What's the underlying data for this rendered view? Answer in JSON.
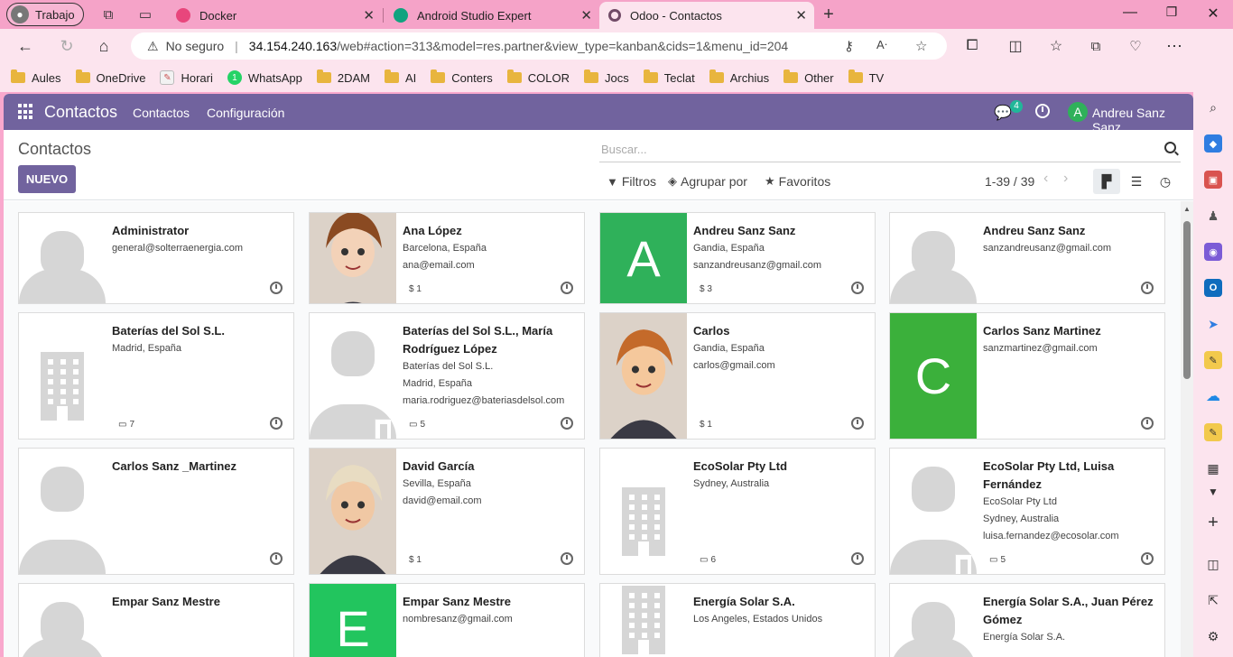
{
  "browser": {
    "profile": "Trabajo",
    "tabs": [
      {
        "title": "Docker",
        "color": "#e8467c"
      },
      {
        "title": "Android Studio Expert",
        "color": "#10a37f"
      },
      {
        "title": "Odoo - Contactos",
        "color": "#714b67"
      }
    ],
    "address": {
      "warning": "No seguro",
      "host": "34.154.240.163",
      "path": "/web#action=313&model=res.partner&view_type=kanban&cids=1&menu_id=204"
    },
    "bookmarks": [
      "Aules",
      "OneDrive",
      "Horari",
      "WhatsApp",
      "2DAM",
      "AI",
      "Conters",
      "COLOR",
      "Jocs",
      "Teclat",
      "Archius",
      "Other",
      "TV"
    ]
  },
  "odoo": {
    "brand": "Contactos",
    "menu": [
      "Contactos",
      "Configuración"
    ],
    "chat_count": "4",
    "user_initial": "A",
    "user_name": "Andreu Sanz Sanz",
    "page_title": "Contactos",
    "new_button": "NUEVO",
    "search_placeholder": "Buscar...",
    "filters_label": "Filtros",
    "group_label": "Agrupar por",
    "favorites_label": "Favoritos",
    "pager": "1-39 / 39",
    "accent": "#71639e"
  },
  "contacts": [
    {
      "name": "Administrator",
      "lines": [
        "general@solterraenergia.com"
      ],
      "meta": ""
    },
    {
      "name": "Ana López",
      "lines": [
        "Barcelona, España",
        "ana@email.com"
      ],
      "meta": "$ 1"
    },
    {
      "name": "Andreu Sanz Sanz",
      "lines": [
        "Gandia, España",
        "sanzandreusanz@gmail.com"
      ],
      "meta": "$ 3"
    },
    {
      "name": "Andreu Sanz Sanz",
      "lines": [
        "sanzandreusanz@gmail.com"
      ],
      "meta": ""
    },
    {
      "name": "Baterías del Sol S.L.",
      "lines": [
        "Madrid, España"
      ],
      "meta": "7"
    },
    {
      "name": "Baterías del Sol S.L., María Rodríguez López",
      "lines": [
        "Baterías del Sol S.L.",
        "Madrid, España",
        "maria.rodriguez@bateriasdelsol.com"
      ],
      "meta": "5"
    },
    {
      "name": "Carlos",
      "lines": [
        "Gandia, España",
        "carlos@gmail.com"
      ],
      "meta": "$ 1"
    },
    {
      "name": "Carlos Sanz Martinez",
      "lines": [
        "sanzmartinez@gmail.com"
      ],
      "meta": ""
    },
    {
      "name": "Carlos Sanz _Martinez",
      "lines": [],
      "meta": ""
    },
    {
      "name": "David García",
      "lines": [
        "Sevilla, España",
        "david@email.com"
      ],
      "meta": "$ 1"
    },
    {
      "name": "EcoSolar Pty Ltd",
      "lines": [
        "Sydney, Australia"
      ],
      "meta": "6"
    },
    {
      "name": "EcoSolar Pty Ltd, Luisa Fernández",
      "lines": [
        "EcoSolar Pty Ltd",
        "Sydney, Australia",
        "luisa.fernandez@ecosolar.com"
      ],
      "meta": "5"
    },
    {
      "name": "Empar Sanz Mestre",
      "lines": [],
      "meta": ""
    },
    {
      "name": "Empar Sanz Mestre",
      "lines": [
        "nombresanz@gmail.com"
      ],
      "meta": ""
    },
    {
      "name": "Energía Solar S.A.",
      "lines": [
        "Los Angeles, Estados Unidos"
      ],
      "meta": ""
    },
    {
      "name": "Energía Solar S.A., Juan Pérez Gómez",
      "lines": [
        "Energía Solar S.A."
      ],
      "meta": ""
    }
  ],
  "avatars": [
    {
      "kind": "person"
    },
    {
      "kind": "portrait",
      "hair": "#8a4a22",
      "skin": "#f3d2b8"
    },
    {
      "kind": "letter",
      "letter": "A",
      "color": "#2fb15a"
    },
    {
      "kind": "person"
    },
    {
      "kind": "building"
    },
    {
      "kind": "person-company"
    },
    {
      "kind": "portrait",
      "hair": "#c46a2a",
      "skin": "#f5c89c"
    },
    {
      "kind": "letter",
      "letter": "C",
      "color": "#3bb03b"
    },
    {
      "kind": "person"
    },
    {
      "kind": "portrait",
      "hair": "#e8dcc2",
      "skin": "#f0c8a4"
    },
    {
      "kind": "building"
    },
    {
      "kind": "person-company"
    },
    {
      "kind": "person"
    },
    {
      "kind": "letter",
      "letter": "E",
      "color": "#22c55e"
    },
    {
      "kind": "building"
    },
    {
      "kind": "person"
    }
  ]
}
